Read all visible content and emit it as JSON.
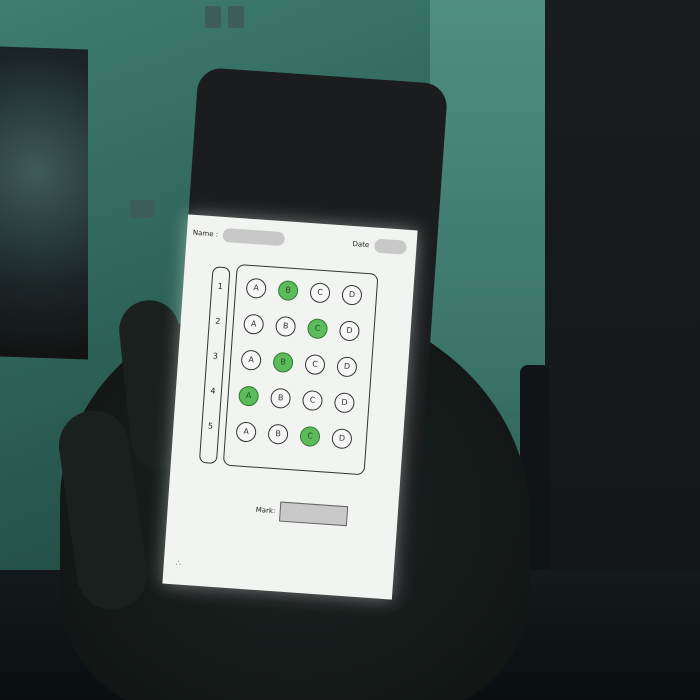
{
  "sheet": {
    "name_label": "Name :",
    "date_label": "Date",
    "mark_label": "Mark:",
    "questions": [
      "1",
      "2",
      "3",
      "4",
      "5"
    ],
    "options": [
      "A",
      "B",
      "C",
      "D"
    ],
    "selected": [
      1,
      2,
      1,
      0,
      2
    ]
  },
  "colors": {
    "selected_bubble": "#5cbb5a",
    "screen": "#f1f4f1",
    "wall": "#3f7d6f"
  },
  "icons": {
    "corner": "small-icon"
  }
}
